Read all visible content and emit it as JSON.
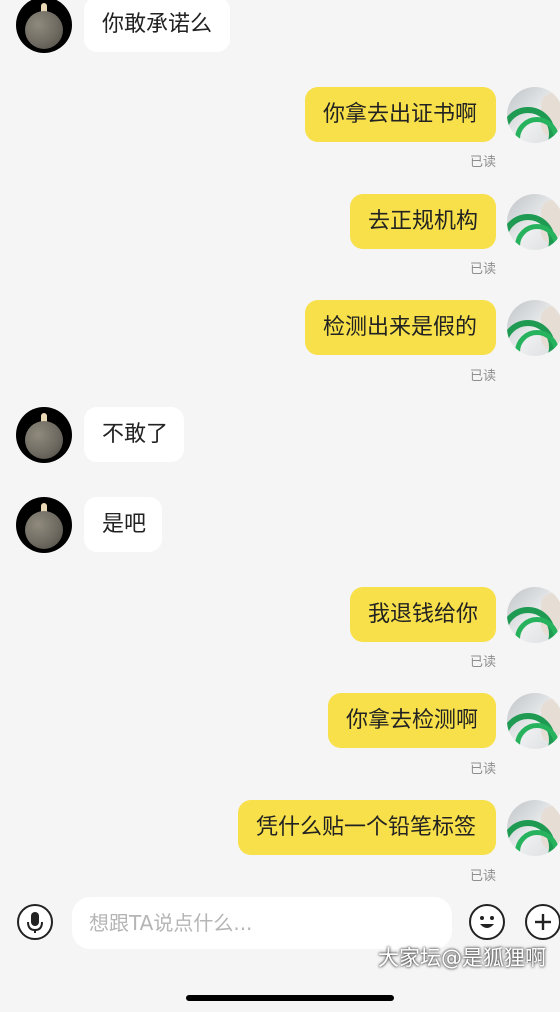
{
  "messages": [
    {
      "side": "left",
      "text": "你敢承诺么"
    },
    {
      "side": "right",
      "text": "你拿去出证书啊",
      "read": "已读"
    },
    {
      "side": "right",
      "text": "去正规机构",
      "read": "已读"
    },
    {
      "side": "right",
      "text": "检测出来是假的",
      "read": "已读"
    },
    {
      "side": "left",
      "text": "不敢了"
    },
    {
      "side": "left",
      "text": "是吧"
    },
    {
      "side": "right",
      "text": "我退钱给你",
      "read": "已读"
    },
    {
      "side": "right",
      "text": "你拿去检测啊",
      "read": "已读"
    },
    {
      "side": "right",
      "text": "凭什么贴一个铅笔标签",
      "read": "已读"
    }
  ],
  "input": {
    "placeholder": "想跟TA说点什么..."
  },
  "icons": {
    "mic": "microphone-icon",
    "emoji": "emoji-icon",
    "plus": "plus-icon"
  },
  "watermark": "大家坛@是狐狸啊"
}
